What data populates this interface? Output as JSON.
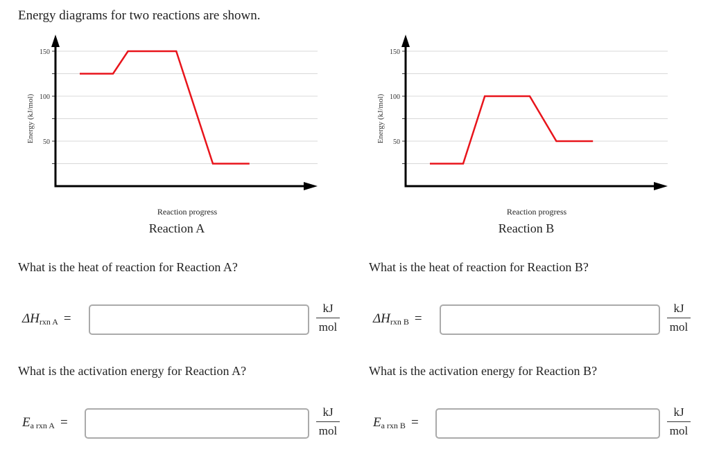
{
  "intro": "Energy diagrams for two reactions are shown.",
  "chart_data": [
    {
      "type": "line",
      "title": "Reaction A",
      "xlabel": "Reaction progress",
      "ylabel": "Energy (kJ/mol)",
      "ylim": [
        0,
        160
      ],
      "yticks": [
        50,
        100,
        150
      ],
      "gridlines": [
        25,
        50,
        75,
        100,
        125,
        150
      ],
      "grid": true,
      "series": [
        {
          "name": "Reaction A",
          "color": "#e8141b",
          "x": [
            0,
            1,
            1.45,
            2.9,
            4,
            5.1
          ],
          "y": [
            125,
            125,
            150,
            150,
            25,
            25
          ]
        }
      ]
    },
    {
      "type": "line",
      "title": "Reaction B",
      "xlabel": "Reaction progress",
      "ylabel": "Energy (kJ/mol)",
      "ylim": [
        0,
        160
      ],
      "yticks": [
        50,
        100,
        150
      ],
      "gridlines": [
        25,
        50,
        75,
        100,
        125,
        150
      ],
      "grid": true,
      "series": [
        {
          "name": "Reaction B",
          "color": "#e8141b",
          "x": [
            0,
            1,
            1.65,
            3,
            3.8,
            4.9
          ],
          "y": [
            25,
            25,
            100,
            100,
            50,
            50
          ]
        }
      ]
    }
  ],
  "questions": {
    "A": {
      "heat_q": "What is the heat of reaction for Reaction A?",
      "heat_symbol": "ΔH",
      "heat_sub": "rxn A",
      "heat_value": "",
      "act_q": "What is the activation energy for Reaction A?",
      "act_symbol": "E",
      "act_sub": "a rxn A",
      "act_value": ""
    },
    "B": {
      "heat_q": "What is the heat of reaction for Reaction B?",
      "heat_symbol": "ΔH",
      "heat_sub": "rxn B",
      "heat_value": "",
      "act_q": "What is the activation energy for Reaction B?",
      "act_symbol": "E",
      "act_sub": "a rxn B",
      "act_value": ""
    }
  },
  "equals": "=",
  "unit": {
    "num": "kJ",
    "den": "mol"
  }
}
